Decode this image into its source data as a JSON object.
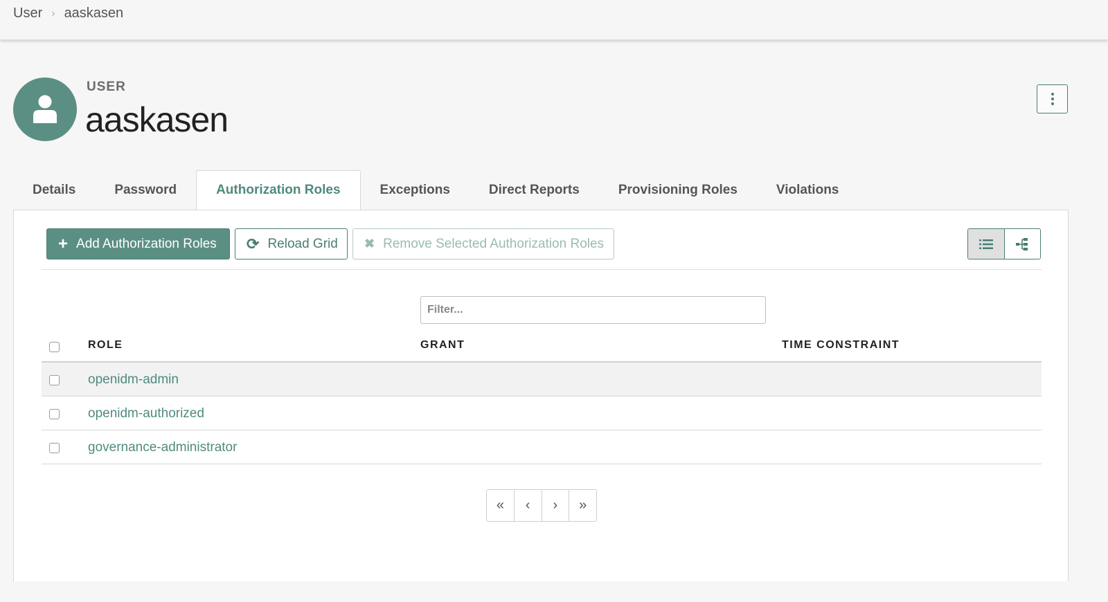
{
  "breadcrumb": {
    "root": "User",
    "current": "aaskasen"
  },
  "header": {
    "kicker": "USER",
    "name": "aaskasen"
  },
  "tabs": [
    {
      "label": "Details"
    },
    {
      "label": "Password"
    },
    {
      "label": "Authorization Roles",
      "active": true
    },
    {
      "label": "Exceptions"
    },
    {
      "label": "Direct Reports"
    },
    {
      "label": "Provisioning Roles"
    },
    {
      "label": "Violations"
    }
  ],
  "toolbar": {
    "add_label": "Add Authorization Roles",
    "reload_label": "Reload Grid",
    "remove_label": "Remove Selected Authorization Roles"
  },
  "filter": {
    "placeholder": "Filter...",
    "value": ""
  },
  "table": {
    "columns": [
      "ROLE",
      "GRANT",
      "TIME CONSTRAINT"
    ],
    "rows": [
      {
        "role": "openidm-admin",
        "grant": "",
        "time_constraint": ""
      },
      {
        "role": "openidm-authorized",
        "grant": "",
        "time_constraint": ""
      },
      {
        "role": "governance-administrator",
        "grant": "",
        "time_constraint": ""
      }
    ]
  },
  "pagination": {
    "first": "«",
    "prev": "‹",
    "next": "›",
    "last": "»"
  },
  "icons": {
    "avatar": "user-icon",
    "kebab": "kebab-menu-icon",
    "add": "plus-icon",
    "reload": "refresh-icon",
    "remove": "close-icon",
    "list_view": "list-view-icon",
    "tree_view": "tree-view-icon"
  },
  "colors": {
    "accent": "#5c8f84",
    "link": "#4f8a7e"
  }
}
